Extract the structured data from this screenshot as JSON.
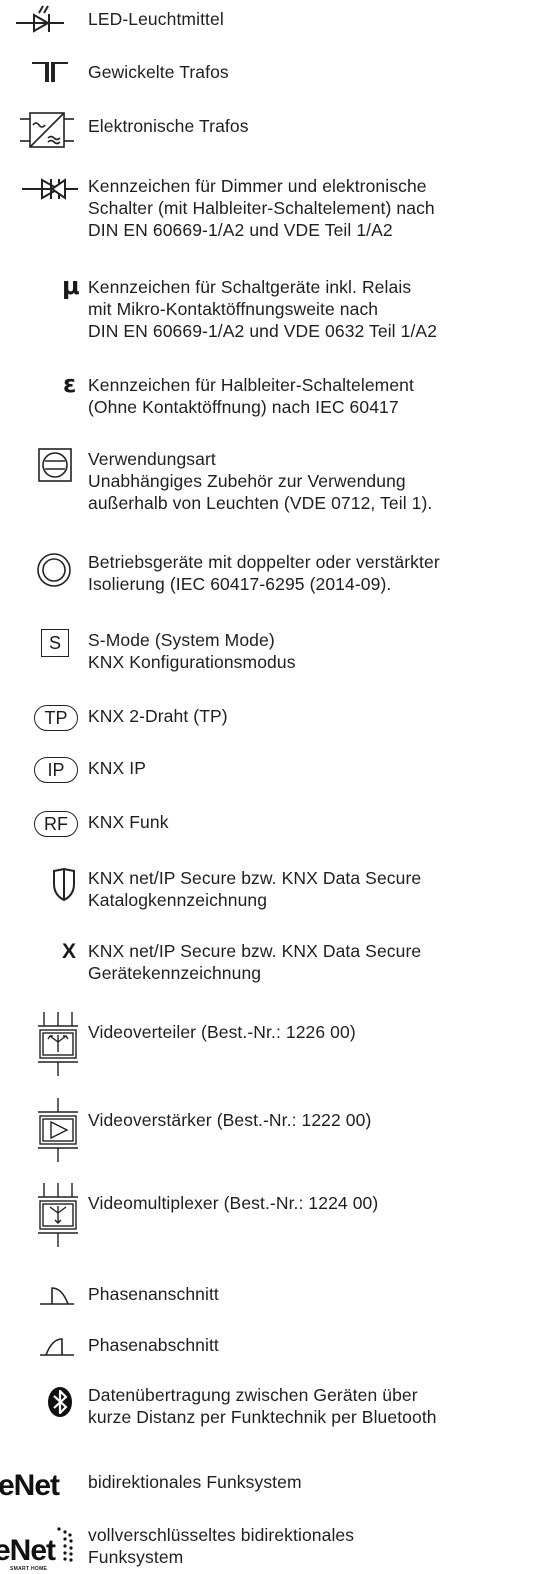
{
  "entries": [
    {
      "icon": "led-lamp-icon",
      "text": "LED-Leuchtmittel"
    },
    {
      "icon": "wound-transformer-icon",
      "text": "Gewickelte Trafos"
    },
    {
      "icon": "electronic-transformer-icon",
      "text": "Elektronische Trafos"
    },
    {
      "icon": "dimmer-thyristor-icon",
      "text": "Kennzeichen für Dimmer und elektronische\nSchalter (mit Halbleiter-Schaltelement) nach\nDIN EN 60669-1/A2 und VDE Teil 1/A2"
    },
    {
      "icon": "micro-contact-icon",
      "symbol": "μ",
      "text": "Kennzeichen für Schaltgeräte inkl. Relais\nmit Mikro-Kontaktöffnungsweite nach\nDIN EN 60669-1/A2 und VDE 0632 Teil 1/A2"
    },
    {
      "icon": "epsilon-icon",
      "symbol": "ε",
      "text": "Kennzeichen für Halbleiter-Schaltelement\n(Ohne Kontaktöffnung) nach IEC 60417"
    },
    {
      "icon": "usage-type-icon",
      "text": "Verwendungsart\nUnabhängiges Zubehör zur Verwendung\naußerhalb von Leuchten (VDE 0712, Teil 1)."
    },
    {
      "icon": "double-insulation-icon",
      "text": "Betriebsgeräte mit doppelter oder verstärkter\nIsolierung (IEC 60417-6295 (2014-09)."
    },
    {
      "icon": "s-mode-icon",
      "symbol": "S",
      "text": "S-Mode (System Mode)\nKNX Konfigurationsmodus"
    },
    {
      "icon": "knx-tp-icon",
      "symbol": "TP",
      "text": "KNX 2-Draht (TP)"
    },
    {
      "icon": "knx-ip-icon",
      "symbol": "IP",
      "text": "KNX IP"
    },
    {
      "icon": "knx-rf-icon",
      "symbol": "RF",
      "text": "KNX Funk"
    },
    {
      "icon": "shield-icon",
      "text": "KNX net/IP Secure bzw. KNX Data Secure\nKatalogkennzeichnung"
    },
    {
      "icon": "x-mark-icon",
      "symbol": "X",
      "text": "KNX net/IP Secure bzw. KNX Data Secure\nGerätekennzeichnung"
    },
    {
      "icon": "video-distributor-icon",
      "text": "Videoverteiler (Best.-Nr.: 1226 00)"
    },
    {
      "icon": "video-amplifier-icon",
      "text": "Videoverstärker (Best.-Nr.: 1222 00)"
    },
    {
      "icon": "video-multiplexer-icon",
      "text": "Videomultiplexer (Best.-Nr.: 1224 00)"
    },
    {
      "icon": "leading-edge-icon",
      "text": "Phasenanschnitt"
    },
    {
      "icon": "trailing-edge-icon",
      "text": "Phasenabschnitt"
    },
    {
      "icon": "bluetooth-icon",
      "text": "Datenübertragung zwischen Geräten über\nkurze Distanz per Funktechnik per Bluetooth"
    },
    {
      "icon": "enet-logo-icon",
      "logo": "eNet",
      "text": "bidirektionales Funksystem"
    },
    {
      "icon": "enet-smart-home-logo-icon",
      "logo": "eNet",
      "logo_sub": "SMART HOME",
      "text": "vollverschlüsseltes bidirektionales\nFunksystem"
    }
  ]
}
